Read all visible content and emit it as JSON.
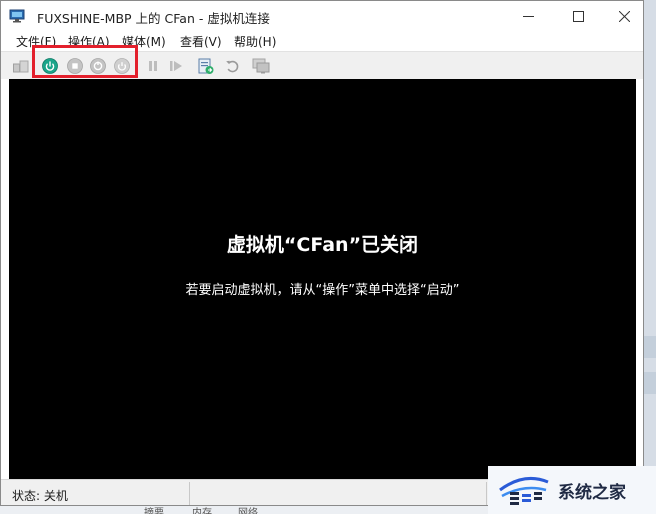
{
  "window": {
    "title": "FUXSHINE-MBP 上的 CFan - 虚拟机连接"
  },
  "menu": {
    "items": [
      {
        "label": "文件(F)"
      },
      {
        "label": "操作(A)"
      },
      {
        "label": "媒体(M)"
      },
      {
        "label": "查看(V)"
      },
      {
        "label": "帮助(H)"
      }
    ]
  },
  "toolbar": {
    "buttons": [
      {
        "name": "ctrl-alt-del-button",
        "icon": "ctrl-alt-del-icon",
        "enabled": false
      },
      {
        "name": "start-button",
        "icon": "power-start-icon",
        "enabled": true
      },
      {
        "name": "turn-off-button",
        "icon": "stop-icon",
        "enabled": false
      },
      {
        "name": "shutdown-button",
        "icon": "shutdown-icon",
        "enabled": false
      },
      {
        "name": "save-button",
        "icon": "save-state-icon",
        "enabled": false
      },
      {
        "name": "pause-button",
        "icon": "pause-icon",
        "enabled": false
      },
      {
        "name": "resume-button",
        "icon": "resume-icon",
        "enabled": false
      },
      {
        "name": "checkpoint-button",
        "icon": "checkpoint-icon",
        "enabled": true
      },
      {
        "name": "revert-button",
        "icon": "revert-icon",
        "enabled": false
      },
      {
        "name": "enhanced-session-button",
        "icon": "enhanced-session-icon",
        "enabled": false
      }
    ],
    "highlight_color": "#e3202c"
  },
  "screen": {
    "title": "虚拟机“CFan”已关闭",
    "subtitle": "若要启动虚拟机，请从“操作”菜单中选择“启动”"
  },
  "status": {
    "text": "状态: 关机"
  },
  "watermark": {
    "text": "系统之家"
  },
  "background_tabs": {
    "items": [
      "摘要",
      "内存",
      "网络"
    ]
  }
}
